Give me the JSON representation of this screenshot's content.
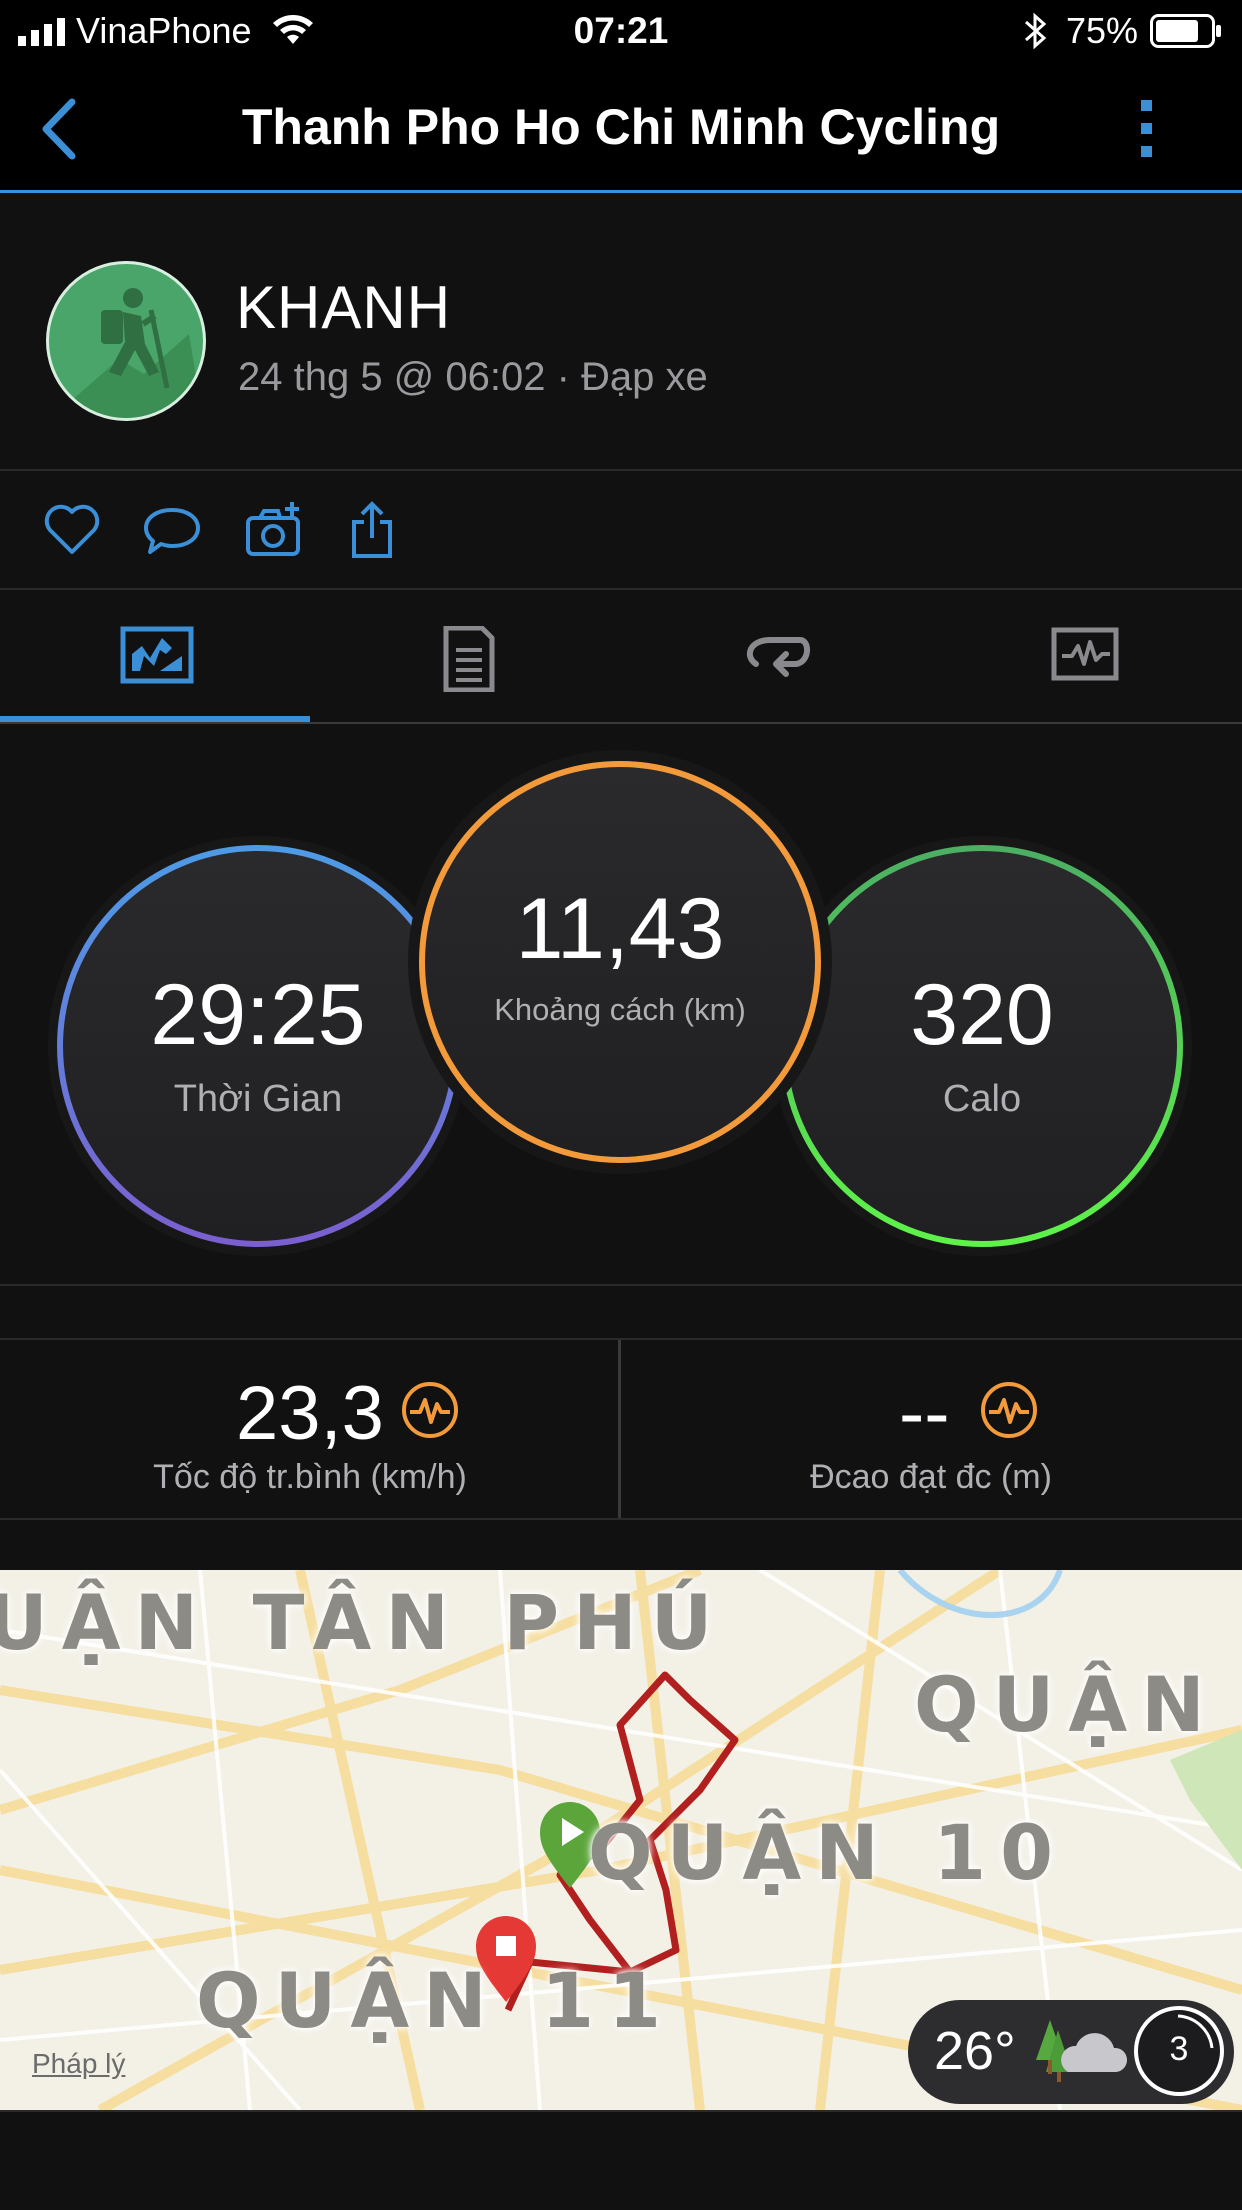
{
  "status_bar": {
    "carrier": "VinaPhone",
    "time": "07:21",
    "battery": "75%"
  },
  "nav": {
    "title": "Thanh Pho Ho Chi Minh Cycling"
  },
  "profile": {
    "name": "KHANH",
    "meta": "24 thg 5 @ 06:02 · Đạp xe"
  },
  "summary": {
    "time": {
      "value": "29:25",
      "label": "Thời Gian"
    },
    "distance": {
      "value": "11,43",
      "label": "Khoảng cách (km)"
    },
    "calories": {
      "value": "320",
      "label": "Calo"
    }
  },
  "stats": {
    "avg_speed": {
      "value": "23,3",
      "label": "Tốc độ tr.bình (km/h)"
    },
    "elevation": {
      "value": "--",
      "label": "Đcao đạt đc (m)"
    }
  },
  "map": {
    "labels": {
      "tan_phu": "UẬN TÂN PHÚ",
      "quan_right": "QUẬN",
      "quan_10": "QUẬN 10",
      "quan_11": "QUẬN 11"
    },
    "legal": "Pháp lý",
    "weather_temp": "26°",
    "zoom_level": "3"
  },
  "colors": {
    "accent": "#3a8fd6",
    "time_ring": "#5f8fe0",
    "distance_ring": "#f39a3a",
    "calorie_ring": "#58e15a",
    "route": "#b21f1f"
  }
}
